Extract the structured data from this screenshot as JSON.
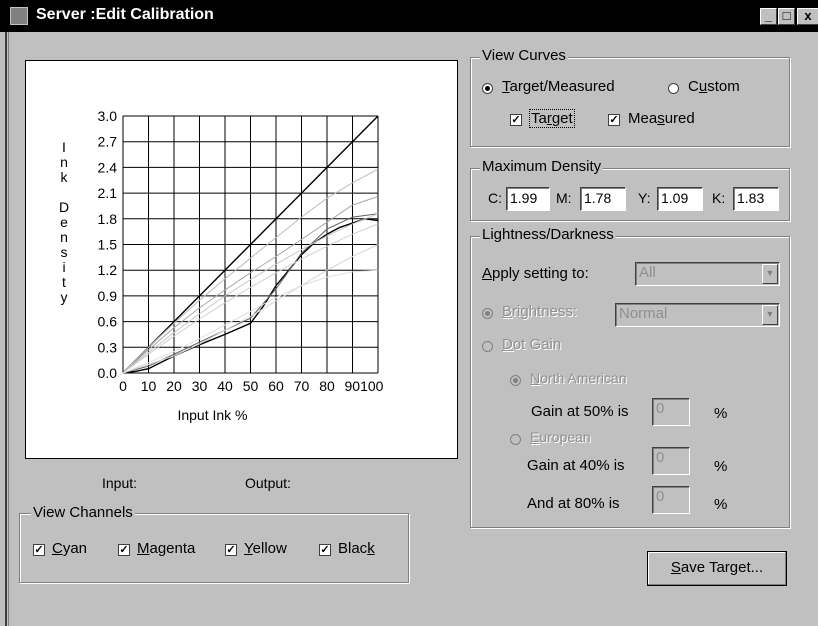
{
  "window": {
    "title": "Server :Edit Calibration",
    "minimize": "_",
    "maximize": "□",
    "close": "x"
  },
  "chart_data": {
    "type": "line",
    "xlabel": "Input Ink %",
    "ylabel": "Ink Density",
    "x_ticks": [
      "0",
      "10",
      "20",
      "30",
      "40",
      "50",
      "60",
      "70",
      "80",
      "90100"
    ],
    "y_ticks": [
      "3.0",
      "2.7",
      "2.4",
      "2.1",
      "1.8",
      "1.5",
      "1.2",
      "0.9",
      "0.6",
      "0.3",
      "0.0"
    ],
    "xlim": [
      0,
      100
    ],
    "ylim": [
      0,
      3.0
    ],
    "grid": true,
    "series": [
      {
        "color": "#000000",
        "x": [
          0,
          100
        ],
        "y": [
          0,
          3.0
        ]
      },
      {
        "color": "#000000",
        "x": [
          0,
          5,
          10,
          20,
          30,
          40,
          50,
          55,
          60,
          65,
          70,
          75,
          80,
          85,
          90,
          95,
          100
        ],
        "y": [
          0,
          0.02,
          0.05,
          0.2,
          0.33,
          0.45,
          0.58,
          0.78,
          1.02,
          1.2,
          1.38,
          1.52,
          1.62,
          1.7,
          1.75,
          1.8,
          1.78
        ]
      },
      {
        "color": "#606060",
        "x": [
          0,
          10,
          20,
          30,
          40,
          50,
          60,
          70,
          80,
          90,
          100
        ],
        "y": [
          0,
          0.08,
          0.22,
          0.36,
          0.5,
          0.64,
          0.98,
          1.4,
          1.68,
          1.82,
          1.86
        ]
      },
      {
        "color": "#a8a8a8",
        "x": [
          0,
          10,
          20,
          30,
          40,
          50,
          60,
          70,
          80,
          90,
          100
        ],
        "y": [
          0,
          0.27,
          0.53,
          0.76,
          0.97,
          1.17,
          1.36,
          1.56,
          1.76,
          1.96,
          2.06
        ]
      },
      {
        "color": "#bcbcbc",
        "x": [
          0,
          10,
          20,
          30,
          40,
          50,
          60,
          70,
          80,
          90,
          100
        ],
        "y": [
          0,
          0.3,
          0.58,
          0.85,
          1.1,
          1.34,
          1.58,
          1.82,
          2.04,
          2.22,
          2.38
        ]
      },
      {
        "color": "#c8c8c8",
        "x": [
          0,
          10,
          20,
          30,
          40,
          50,
          60,
          70,
          80,
          90,
          100
        ],
        "y": [
          0,
          0.24,
          0.47,
          0.69,
          0.9,
          1.09,
          1.27,
          1.44,
          1.6,
          1.74,
          1.86
        ]
      },
      {
        "color": "#d0d0d0",
        "x": [
          0,
          10,
          20,
          30,
          40,
          50,
          60,
          70,
          80,
          90,
          100
        ],
        "y": [
          0,
          0.22,
          0.43,
          0.63,
          0.82,
          1.0,
          1.17,
          1.33,
          1.48,
          1.62,
          1.74
        ]
      },
      {
        "color": "#d6d6d6",
        "x": [
          0,
          10,
          20,
          30,
          40,
          50,
          60,
          70,
          80,
          90,
          100
        ],
        "y": [
          0,
          0.1,
          0.2,
          0.34,
          0.5,
          0.66,
          0.84,
          1.02,
          1.2,
          1.36,
          1.5
        ]
      },
      {
        "color": "#e0e0e0",
        "x": [
          0,
          10,
          20,
          30,
          40,
          50,
          60,
          70,
          80,
          90,
          100
        ],
        "y": [
          0,
          0.12,
          0.25,
          0.4,
          0.56,
          0.72,
          0.88,
          1.02,
          1.12,
          1.18,
          1.2
        ]
      }
    ]
  },
  "chart_axis_letters": [
    "I",
    "n",
    "k",
    "",
    "D",
    "e",
    "n",
    "s",
    "i",
    "t",
    "y"
  ],
  "io": {
    "input_label": "Input:",
    "output_label": "Output:"
  },
  "view_channels": {
    "legend": "View Channels",
    "items": [
      {
        "pre": "",
        "u": "C",
        "post": "yan",
        "checked": "✓"
      },
      {
        "pre": "",
        "u": "M",
        "post": "agenta",
        "checked": "✓"
      },
      {
        "pre": "",
        "u": "Y",
        "post": "ellow",
        "checked": "✓"
      },
      {
        "pre": "Blac",
        "u": "k",
        "post": "",
        "checked": "✓"
      }
    ]
  },
  "view_curves": {
    "legend": "View Curves",
    "target_measured": {
      "pre": "",
      "u": "T",
      "post": "arget/Measured",
      "selected": true
    },
    "custom": {
      "pre": "C",
      "u": "u",
      "post": "stom",
      "selected": false
    },
    "target_check": {
      "pre": "Ta",
      "u": "r",
      "post": "get",
      "checked": "✓"
    },
    "measured_check": {
      "pre": "Mea",
      "u": "s",
      "post": "ured",
      "checked": "✓"
    }
  },
  "max_density": {
    "legend": "Maximum Density",
    "c_label": "C:",
    "c_value": "1.99",
    "m_label": "M:",
    "m_value": "1.78",
    "y_label": "Y:",
    "y_value": "1.09",
    "k_label": "K:",
    "k_value": "1.83"
  },
  "lightness": {
    "legend": "Lightness/Darkness",
    "apply": {
      "pre": "",
      "u": "A",
      "post": "pply setting to:"
    },
    "apply_value": "All",
    "brightness": {
      "pre": "",
      "u": "B",
      "post": "rightness:"
    },
    "brightness_value": "Normal",
    "dot_gain": {
      "pre": "",
      "u": "D",
      "post": "ot Gain"
    },
    "north_american": {
      "pre": "",
      "u": "N",
      "post": "orth American"
    },
    "gain50_label": "Gain at 50% is",
    "gain50_value": "0",
    "gain50_unit": "%",
    "european": {
      "pre": "",
      "u": "E",
      "post": "uropean"
    },
    "gain40_label": "Gain at 40% is",
    "gain40_value": "0",
    "gain40_unit": "%",
    "and80_label": "And at 80% is",
    "and80_value": "0",
    "and80_unit": "%"
  },
  "save_button": {
    "pre": "",
    "u": "S",
    "post": "ave Target..."
  }
}
